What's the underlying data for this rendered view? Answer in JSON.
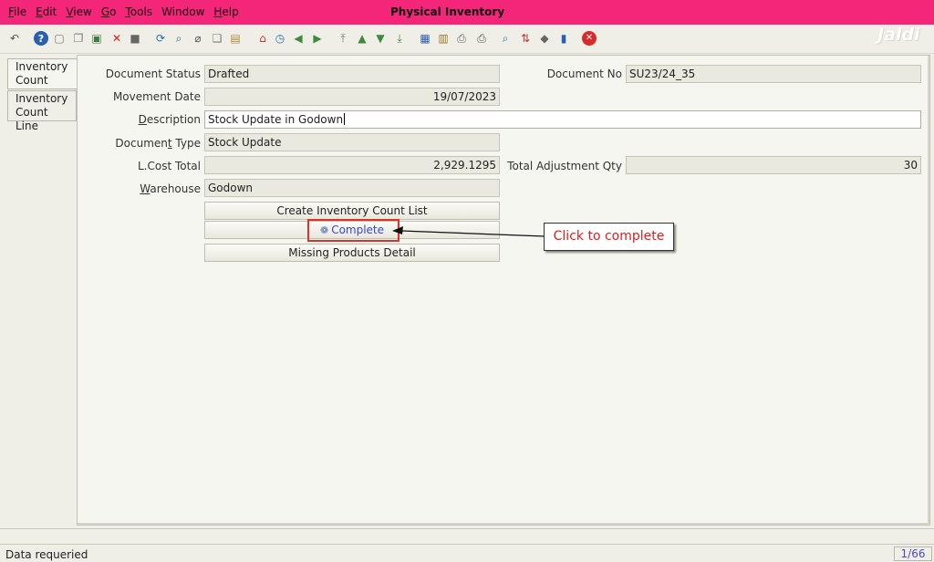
{
  "window": {
    "title": "Physical Inventory"
  },
  "menu": [
    {
      "u": "F",
      "rest": "ile"
    },
    {
      "u": "E",
      "rest": "dit"
    },
    {
      "u": "V",
      "rest": "iew"
    },
    {
      "u": "G",
      "rest": "o"
    },
    {
      "u": "T",
      "rest": "ools"
    },
    {
      "u": "",
      "rest": "Window"
    },
    {
      "u": "H",
      "rest": "elp"
    }
  ],
  "watermark": "Jaldi",
  "toolbar_icons": [
    {
      "name": "undo-icon",
      "glyph": "↶",
      "color": "#555555"
    },
    {
      "name": "help-icon",
      "glyph": "?",
      "color": "#2a5fb0"
    },
    {
      "name": "new-record-icon",
      "glyph": "▢",
      "color": "#777777"
    },
    {
      "name": "copy-record-icon",
      "glyph": "❐",
      "color": "#777777"
    },
    {
      "name": "save-icon",
      "glyph": "▣",
      "color": "#3d7a3d"
    },
    {
      "name": "delete-icon",
      "glyph": "✕",
      "color": "#d22020"
    },
    {
      "name": "delete-selection-icon",
      "glyph": "■",
      "color": "#666666"
    },
    {
      "name": "refresh-icon",
      "glyph": "⟳",
      "color": "#2a6fb0"
    },
    {
      "name": "find-icon",
      "glyph": "⌕",
      "color": "#2a5fb0"
    },
    {
      "name": "attachment-icon",
      "glyph": "⌀",
      "color": "#555555"
    },
    {
      "name": "chat-icon",
      "glyph": "❏",
      "color": "#777777"
    },
    {
      "name": "history-icon",
      "glyph": "▤",
      "color": "#b08a3a"
    },
    {
      "name": "home-icon",
      "glyph": "⌂",
      "color": "#c43030"
    },
    {
      "name": "menu-icon",
      "glyph": "◷",
      "color": "#2a6fb0"
    },
    {
      "name": "parent-record-icon",
      "glyph": "◀",
      "color": "#3d8a3d"
    },
    {
      "name": "detail-record-icon",
      "glyph": "▶",
      "color": "#3d8a3d"
    },
    {
      "name": "first-record-icon",
      "glyph": "⤒",
      "color": "#777777"
    },
    {
      "name": "previous-record-icon",
      "glyph": "▲",
      "color": "#3d8a3d"
    },
    {
      "name": "next-record-icon",
      "glyph": "▼",
      "color": "#3d8a3d"
    },
    {
      "name": "last-record-icon",
      "glyph": "⤓",
      "color": "#3d8a3d"
    },
    {
      "name": "report-icon",
      "glyph": "▦",
      "color": "#2a5fb0"
    },
    {
      "name": "archive-icon",
      "glyph": "▥",
      "color": "#a07a2a"
    },
    {
      "name": "print-preview-icon",
      "glyph": "⎙",
      "color": "#666666"
    },
    {
      "name": "print-icon",
      "glyph": "⎙",
      "color": "#555555"
    },
    {
      "name": "zoom-icon",
      "glyph": "⌕",
      "color": "#2a6fb0"
    },
    {
      "name": "workflow-icon",
      "glyph": "⇅",
      "color": "#c43030"
    },
    {
      "name": "product-info-icon",
      "glyph": "◆",
      "color": "#666666"
    },
    {
      "name": "request-icon",
      "glyph": "▮",
      "color": "#2a5fb0"
    },
    {
      "name": "close-window-icon",
      "glyph": "✕",
      "color": "#ffffff"
    }
  ],
  "tabs": [
    {
      "label_1": "Inventory",
      "label_2": "Count"
    },
    {
      "label_1": "Inventory",
      "label_2": "Count Line"
    }
  ],
  "form": {
    "document_status": {
      "label": "Document Status",
      "value": "Drafted"
    },
    "document_no": {
      "label": "Document No",
      "value": "SU23/24_35"
    },
    "movement_date": {
      "label": "Movement Date",
      "value": "19/07/2023"
    },
    "description": {
      "label_u": "D",
      "label_rest": "escription",
      "value": "Stock Update in Godown"
    },
    "document_type": {
      "label_pre": "Documen",
      "label_u": "t",
      "label_rest": " Type",
      "value": "Stock Update"
    },
    "lcost_total": {
      "label": "L.Cost Total",
      "value": "2,929.1295"
    },
    "total_adjustment_qty": {
      "label": "Total Adjustment Qty",
      "value": "30"
    },
    "warehouse": {
      "label_u": "W",
      "label_rest": "arehouse",
      "value": "Godown"
    }
  },
  "buttons": {
    "create_count_list": "Create Inventory Count List",
    "complete": "Complete",
    "missing_products": "Missing Products Detail"
  },
  "annotation": {
    "callout": "Click to complete",
    "color": "#e11b1b"
  },
  "status": {
    "message": "Data requeried",
    "record_count": "1/66"
  }
}
